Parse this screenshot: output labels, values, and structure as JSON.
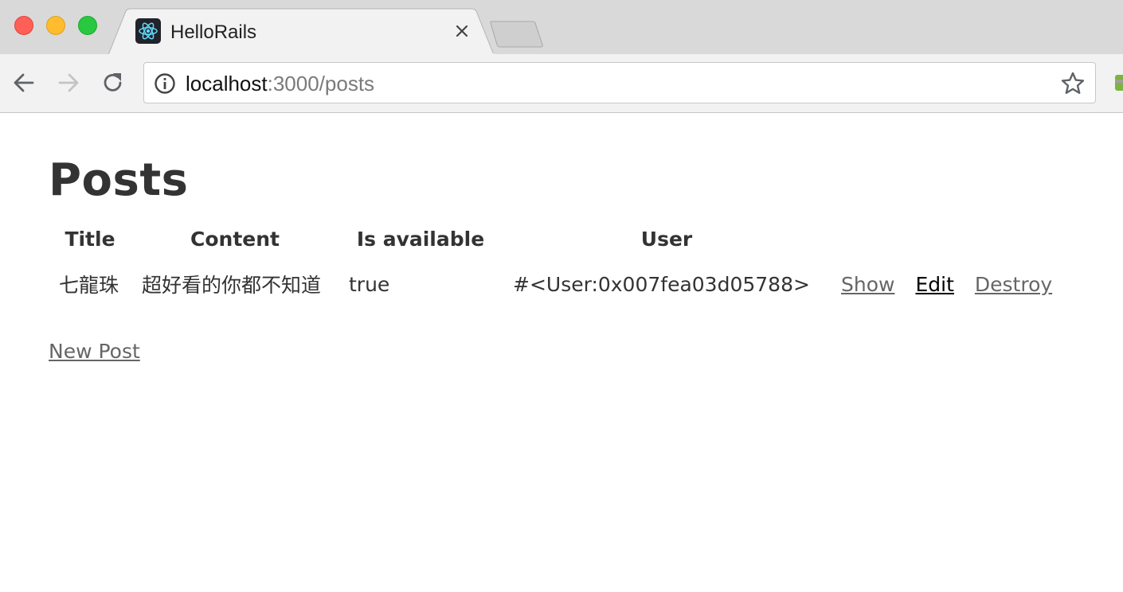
{
  "browser": {
    "tab": {
      "title": "HelloRails",
      "favicon": "react-logo-icon"
    },
    "address_bar": {
      "host": "localhost",
      "rest": ":3000/posts"
    },
    "colors": {
      "tabstrip": "#d9d9d9",
      "toolbar": "#f2f2f2",
      "favicon_bg": "#20232a",
      "favicon_fg": "#61dafb"
    }
  },
  "page": {
    "title": "Posts",
    "table": {
      "headers": [
        "Title",
        "Content",
        "Is available",
        "User"
      ],
      "rows": [
        {
          "title": "七龍珠",
          "content": "超好看的你都不知道",
          "is_available": "true",
          "user": "#<User:0x007fea03d05788>",
          "actions": {
            "show": "Show",
            "edit": "Edit",
            "destroy": "Destroy"
          }
        }
      ]
    },
    "new_post_link": "New Post"
  }
}
